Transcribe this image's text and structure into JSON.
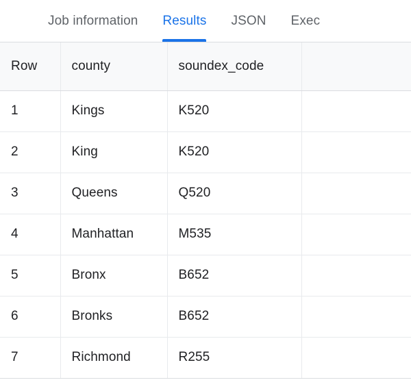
{
  "tabs": [
    {
      "label": "Job information",
      "active": false
    },
    {
      "label": "Results",
      "active": true
    },
    {
      "label": "JSON",
      "active": false
    },
    {
      "label": "Exec",
      "active": false,
      "truncated": true
    }
  ],
  "accent_color": "#1a73e8",
  "inactive_tab_color": "#5f6368",
  "header_background": "#f8f9fa",
  "grid_line_color": "#e8eaed",
  "results_table": {
    "columns": [
      "Row",
      "county",
      "soundex_code",
      ""
    ],
    "rows": [
      {
        "row": "1",
        "county": "Kings",
        "soundex_code": "K520",
        "extra": ""
      },
      {
        "row": "2",
        "county": "King",
        "soundex_code": "K520",
        "extra": ""
      },
      {
        "row": "3",
        "county": "Queens",
        "soundex_code": "Q520",
        "extra": ""
      },
      {
        "row": "4",
        "county": "Manhattan",
        "soundex_code": "M535",
        "extra": ""
      },
      {
        "row": "5",
        "county": "Bronx",
        "soundex_code": "B652",
        "extra": ""
      },
      {
        "row": "6",
        "county": "Bronks",
        "soundex_code": "B652",
        "extra": ""
      },
      {
        "row": "7",
        "county": "Richmond",
        "soundex_code": "R255",
        "extra": ""
      }
    ]
  }
}
